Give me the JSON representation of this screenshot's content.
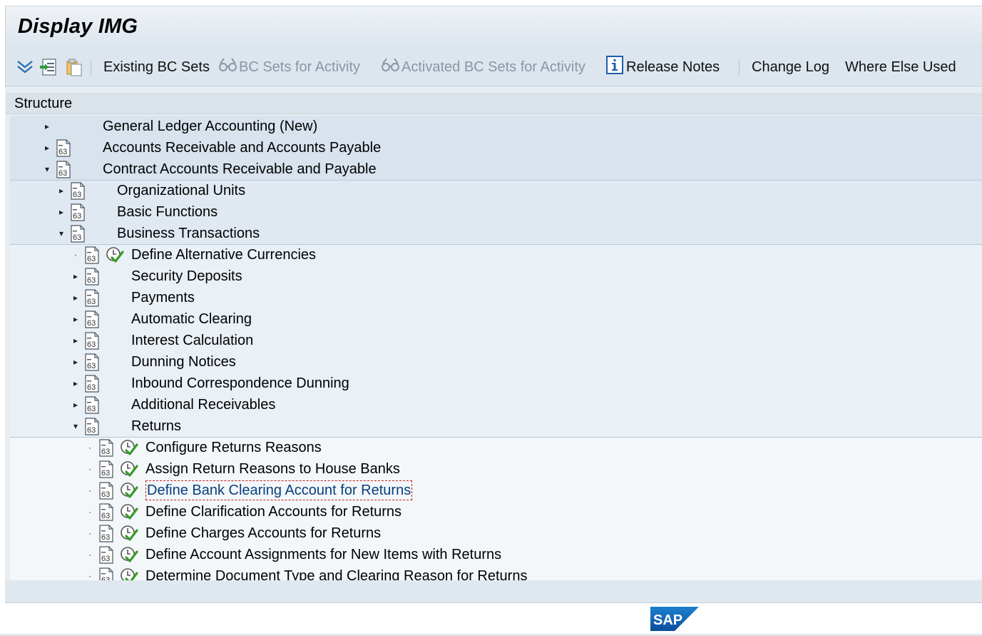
{
  "window": {
    "title": "Display IMG"
  },
  "toolbar": {
    "existing_bc_sets": "Existing BC Sets",
    "bc_sets_for_activity": "BC Sets for Activity",
    "activated_bc_sets": "Activated BC Sets for Activity",
    "release_notes": "Release Notes",
    "change_log": "Change Log",
    "where_else_used": "Where Else Used"
  },
  "tree": {
    "header": "Structure",
    "items": [
      {
        "label": "General Ledger Accounting (New)",
        "level": 0,
        "state": "collapsed",
        "doc": false,
        "exec": false
      },
      {
        "label": "Accounts Receivable and Accounts Payable",
        "level": 0,
        "state": "collapsed",
        "doc": true,
        "exec": false
      },
      {
        "label": "Contract Accounts Receivable and Payable",
        "level": 0,
        "state": "expanded",
        "doc": true,
        "exec": false
      },
      {
        "label": "Organizational Units",
        "level": 1,
        "state": "collapsed",
        "doc": true,
        "exec": false
      },
      {
        "label": "Basic Functions",
        "level": 1,
        "state": "collapsed",
        "doc": true,
        "exec": false
      },
      {
        "label": "Business Transactions",
        "level": 1,
        "state": "expanded",
        "doc": true,
        "exec": false
      },
      {
        "label": "Define Alternative Currencies",
        "level": 2,
        "state": "leaf",
        "doc": true,
        "exec": true
      },
      {
        "label": "Security Deposits",
        "level": 2,
        "state": "collapsed",
        "doc": true,
        "exec": false
      },
      {
        "label": "Payments",
        "level": 2,
        "state": "collapsed",
        "doc": true,
        "exec": false
      },
      {
        "label": "Automatic Clearing",
        "level": 2,
        "state": "collapsed",
        "doc": true,
        "exec": false
      },
      {
        "label": "Interest Calculation",
        "level": 2,
        "state": "collapsed",
        "doc": true,
        "exec": false
      },
      {
        "label": "Dunning Notices",
        "level": 2,
        "state": "collapsed",
        "doc": true,
        "exec": false
      },
      {
        "label": "Inbound Correspondence Dunning",
        "level": 2,
        "state": "collapsed",
        "doc": true,
        "exec": false
      },
      {
        "label": "Additional Receivables",
        "level": 2,
        "state": "collapsed",
        "doc": true,
        "exec": false
      },
      {
        "label": "Returns",
        "level": 2,
        "state": "expanded",
        "doc": true,
        "exec": false
      },
      {
        "label": "Configure Returns Reasons",
        "level": 3,
        "state": "leaf",
        "doc": true,
        "exec": true
      },
      {
        "label": "Assign Return Reasons to House Banks",
        "level": 3,
        "state": "leaf",
        "doc": true,
        "exec": true
      },
      {
        "label": "Define Bank Clearing Account for Returns",
        "level": 3,
        "state": "leaf",
        "doc": true,
        "exec": true,
        "selected": true
      },
      {
        "label": "Define Clarification Accounts for Returns",
        "level": 3,
        "state": "leaf",
        "doc": true,
        "exec": true
      },
      {
        "label": "Define Charges Accounts for Returns",
        "level": 3,
        "state": "leaf",
        "doc": true,
        "exec": true
      },
      {
        "label": "Define Account Assignments for New Items with Returns",
        "level": 3,
        "state": "leaf",
        "doc": true,
        "exec": true
      },
      {
        "label": "Determine Document Type and Clearing Reason for Returns",
        "level": 3,
        "state": "leaf",
        "doc": true,
        "exec": true
      }
    ]
  },
  "brand": {
    "logo": "SAP"
  },
  "colors": {
    "link": "#0a3f7a",
    "selection_border": "#c0201e",
    "check_green": "#3a9a2a"
  }
}
